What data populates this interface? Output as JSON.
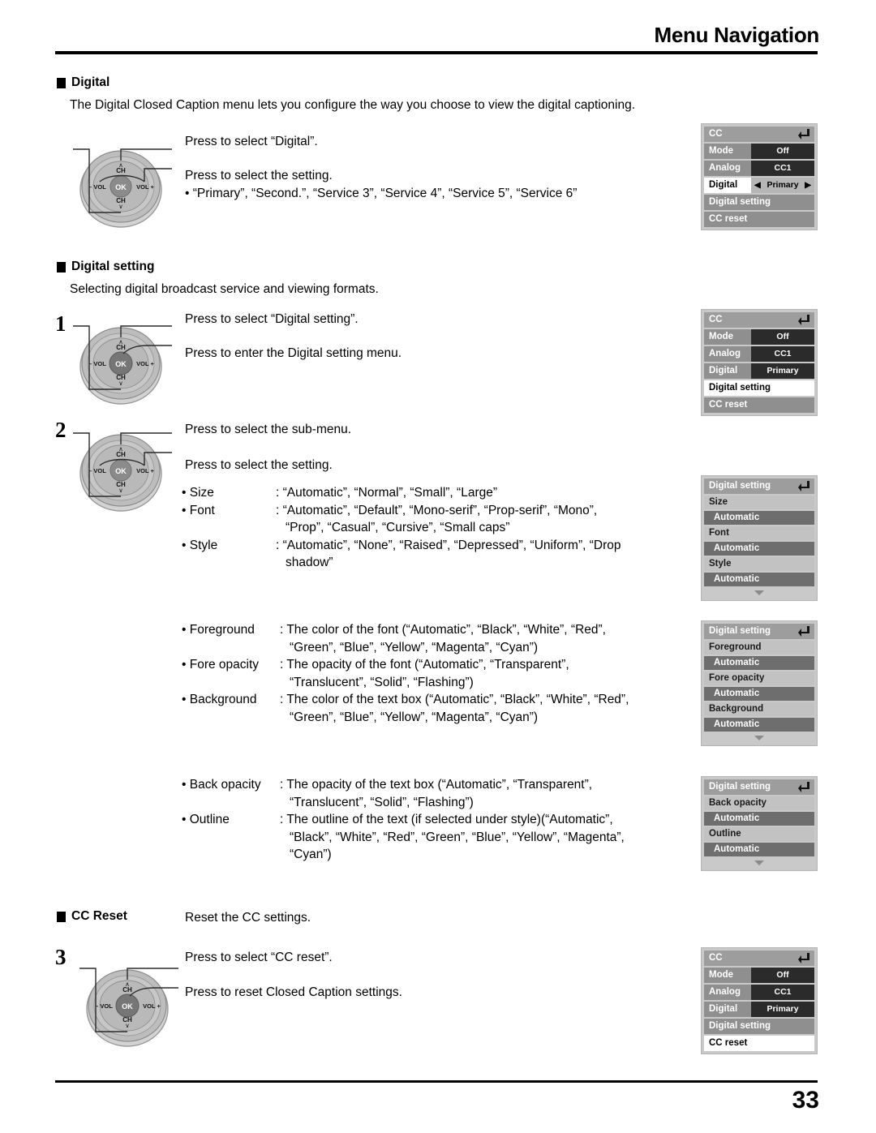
{
  "header": {
    "title": "Menu Navigation"
  },
  "footer": {
    "page_number": "33"
  },
  "sections": {
    "digital": {
      "heading": "Digital",
      "description": "The Digital Closed Caption menu lets you configure the way you choose to view the digital captioning.",
      "callout_1": "Press to select “Digital”.",
      "callout_2": "Press to select the setting.",
      "callout_2_bullet": "•  “Primary”, “Second.”, “Service 3”, “Service 4”, “Service 5”, “Service 6”"
    },
    "digital_setting": {
      "heading": "Digital setting",
      "description": "Selecting digital broadcast service and viewing formats.",
      "step1_number": "1",
      "step1_callout_1": "Press to select “Digital setting”.",
      "step1_callout_2": "Press to enter the Digital setting menu.",
      "step2_number": "2",
      "step2_callout_1": "Press to select the sub-menu.",
      "step2_callout_2": "Press to select the setting."
    },
    "cc_reset": {
      "heading": "CC Reset",
      "description": "Reset the CC settings.",
      "step3_number": "3",
      "step3_callout_1": "Press to select “CC reset”.",
      "step3_callout_2": "Press to reset Closed Caption settings."
    }
  },
  "spec_lists": {
    "group_a": [
      {
        "key": "• Size",
        "value": ": “Automatic”, “Normal”, “Small”, “Large”",
        "cont": ""
      },
      {
        "key": "• Font",
        "value": ": “Automatic”, “Default”, “Mono-serif”, “Prop-serif”, “Mono”,",
        "cont": "“Prop”, “Casual”, “Cursive”, “Small caps”"
      },
      {
        "key": "• Style",
        "value": ": “Automatic”, “None”, “Raised”, “Depressed”, “Uniform”, “Drop",
        "cont": "shadow”"
      }
    ],
    "group_b": [
      {
        "key": "• Foreground",
        "value": ": The color of the font (“Automatic”, “Black”, “White”, “Red”,",
        "cont": "“Green”, “Blue”, “Yellow”, “Magenta”, “Cyan”)"
      },
      {
        "key": "• Fore opacity",
        "value": ": The opacity of the font (“Automatic”, “Transparent”,",
        "cont": "“Translucent”, “Solid”, “Flashing”)"
      },
      {
        "key": "• Background",
        "value": ": The color of the text box (“Automatic”, “Black”, “White”, “Red”,",
        "cont": "“Green”, “Blue”, “Yellow”, “Magenta”, “Cyan”)"
      }
    ],
    "group_c": [
      {
        "key": "• Back opacity",
        "value": ": The  opacity  of  the  text  box  (“Automatic”,  “Transparent”,",
        "cont": "“Translucent”, “Solid”, “Flashing”)"
      },
      {
        "key": "• Outline",
        "value": ": The outline of the text (if selected under style)(“Automatic”,",
        "cont": "“Black”, “White”, “Red”, “Green”, “Blue”, “Yellow”, “Magenta”,",
        "cont2": "“Cyan”)"
      }
    ]
  },
  "remote": {
    "ch_up": "CH",
    "ch_down": "CH",
    "vol_minus": "– VOL",
    "vol_plus": "VOL +",
    "ok": "OK"
  },
  "osd_panels": {
    "cc_digital": {
      "title": "CC",
      "rows": [
        {
          "label": "Mode",
          "value": "Off",
          "selected": false,
          "arrows": false
        },
        {
          "label": "Analog",
          "value": "CC1",
          "selected": false,
          "arrows": false
        },
        {
          "label": "Digital",
          "value": "Primary",
          "selected": true,
          "arrows": true
        }
      ],
      "full_rows": [
        {
          "label": "Digital setting",
          "selected": false
        },
        {
          "label": "CC reset",
          "selected": false
        }
      ]
    },
    "cc_digital_setting": {
      "title": "CC",
      "rows": [
        {
          "label": "Mode",
          "value": "Off",
          "selected": false,
          "arrows": false
        },
        {
          "label": "Analog",
          "value": "CC1",
          "selected": false,
          "arrows": false
        },
        {
          "label": "Digital",
          "value": "Primary",
          "selected": false,
          "arrows": false
        }
      ],
      "full_rows": [
        {
          "label": "Digital setting",
          "selected": true
        },
        {
          "label": "CC reset",
          "selected": false
        }
      ]
    },
    "ds_size": {
      "title": "Digital setting",
      "items": [
        {
          "label": "Size",
          "value": "Automatic"
        },
        {
          "label": "Font",
          "value": "Automatic"
        },
        {
          "label": "Style",
          "value": "Automatic"
        }
      ],
      "more": true
    },
    "ds_foreground": {
      "title": "Digital setting",
      "items": [
        {
          "label": "Foreground",
          "value": "Automatic"
        },
        {
          "label": "Fore opacity",
          "value": "Automatic"
        },
        {
          "label": "Background",
          "value": "Automatic"
        }
      ],
      "more": true
    },
    "ds_backopacity": {
      "title": "Digital setting",
      "items": [
        {
          "label": "Back opacity",
          "value": "Automatic"
        },
        {
          "label": "Outline",
          "value": "Automatic"
        }
      ],
      "more": true
    },
    "cc_reset": {
      "title": "CC",
      "rows": [
        {
          "label": "Mode",
          "value": "Off",
          "selected": false,
          "arrows": false
        },
        {
          "label": "Analog",
          "value": "CC1",
          "selected": false,
          "arrows": false
        },
        {
          "label": "Digital",
          "value": "Primary",
          "selected": false,
          "arrows": false
        }
      ],
      "full_rows": [
        {
          "label": "Digital setting",
          "selected": false
        },
        {
          "label": "CC reset",
          "selected": true
        }
      ]
    }
  },
  "colors": {
    "osd_frame": "#c9c9c9",
    "osd_title_bg": "#9d9d9d",
    "osd_label_bg": "#8f8f8f",
    "osd_value_bg": "#2b2b2b",
    "osd_selected_bg": "#ffffff",
    "ds_label_bg": "#c2c2c2",
    "ds_value_bg": "#6e6e6e"
  }
}
